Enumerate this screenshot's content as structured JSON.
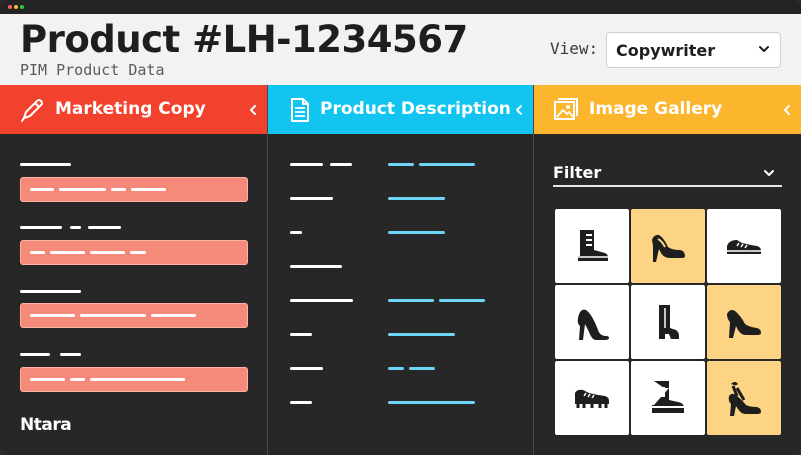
{
  "header": {
    "title": "Product #LH-1234567",
    "subtitle": "PIM Product Data",
    "view_label": "View:",
    "view_selected": "Copywriter"
  },
  "colors": {
    "marketing": "#f2422d",
    "description": "#11c5f0",
    "gallery": "#fbb62d",
    "highlight_tile": "#fdd483",
    "field_fill": "#f58a7b",
    "line_blue": "#6fd5f6"
  },
  "panels": {
    "marketing": {
      "title": "Marketing Copy",
      "icon": "pen-icon",
      "fields": 4
    },
    "description": {
      "title": "Product Description",
      "icon": "document-icon",
      "rows": 8
    },
    "gallery": {
      "title": "Image Gallery",
      "icon": "image-icon",
      "filter_label": "Filter",
      "tiles": [
        {
          "icon": "boot-icon",
          "highlighted": false
        },
        {
          "icon": "heel-icon",
          "highlighted": true
        },
        {
          "icon": "sneaker-icon",
          "highlighted": false
        },
        {
          "icon": "pump-icon",
          "highlighted": false
        },
        {
          "icon": "ankle-boot-icon",
          "highlighted": false
        },
        {
          "icon": "pump-icon",
          "highlighted": true
        },
        {
          "icon": "cleat-icon",
          "highlighted": false
        },
        {
          "icon": "hiking-boot-icon",
          "highlighted": false
        },
        {
          "icon": "strappy-heel-icon",
          "highlighted": true
        }
      ]
    }
  },
  "branding": {
    "logo": "Ntara"
  }
}
